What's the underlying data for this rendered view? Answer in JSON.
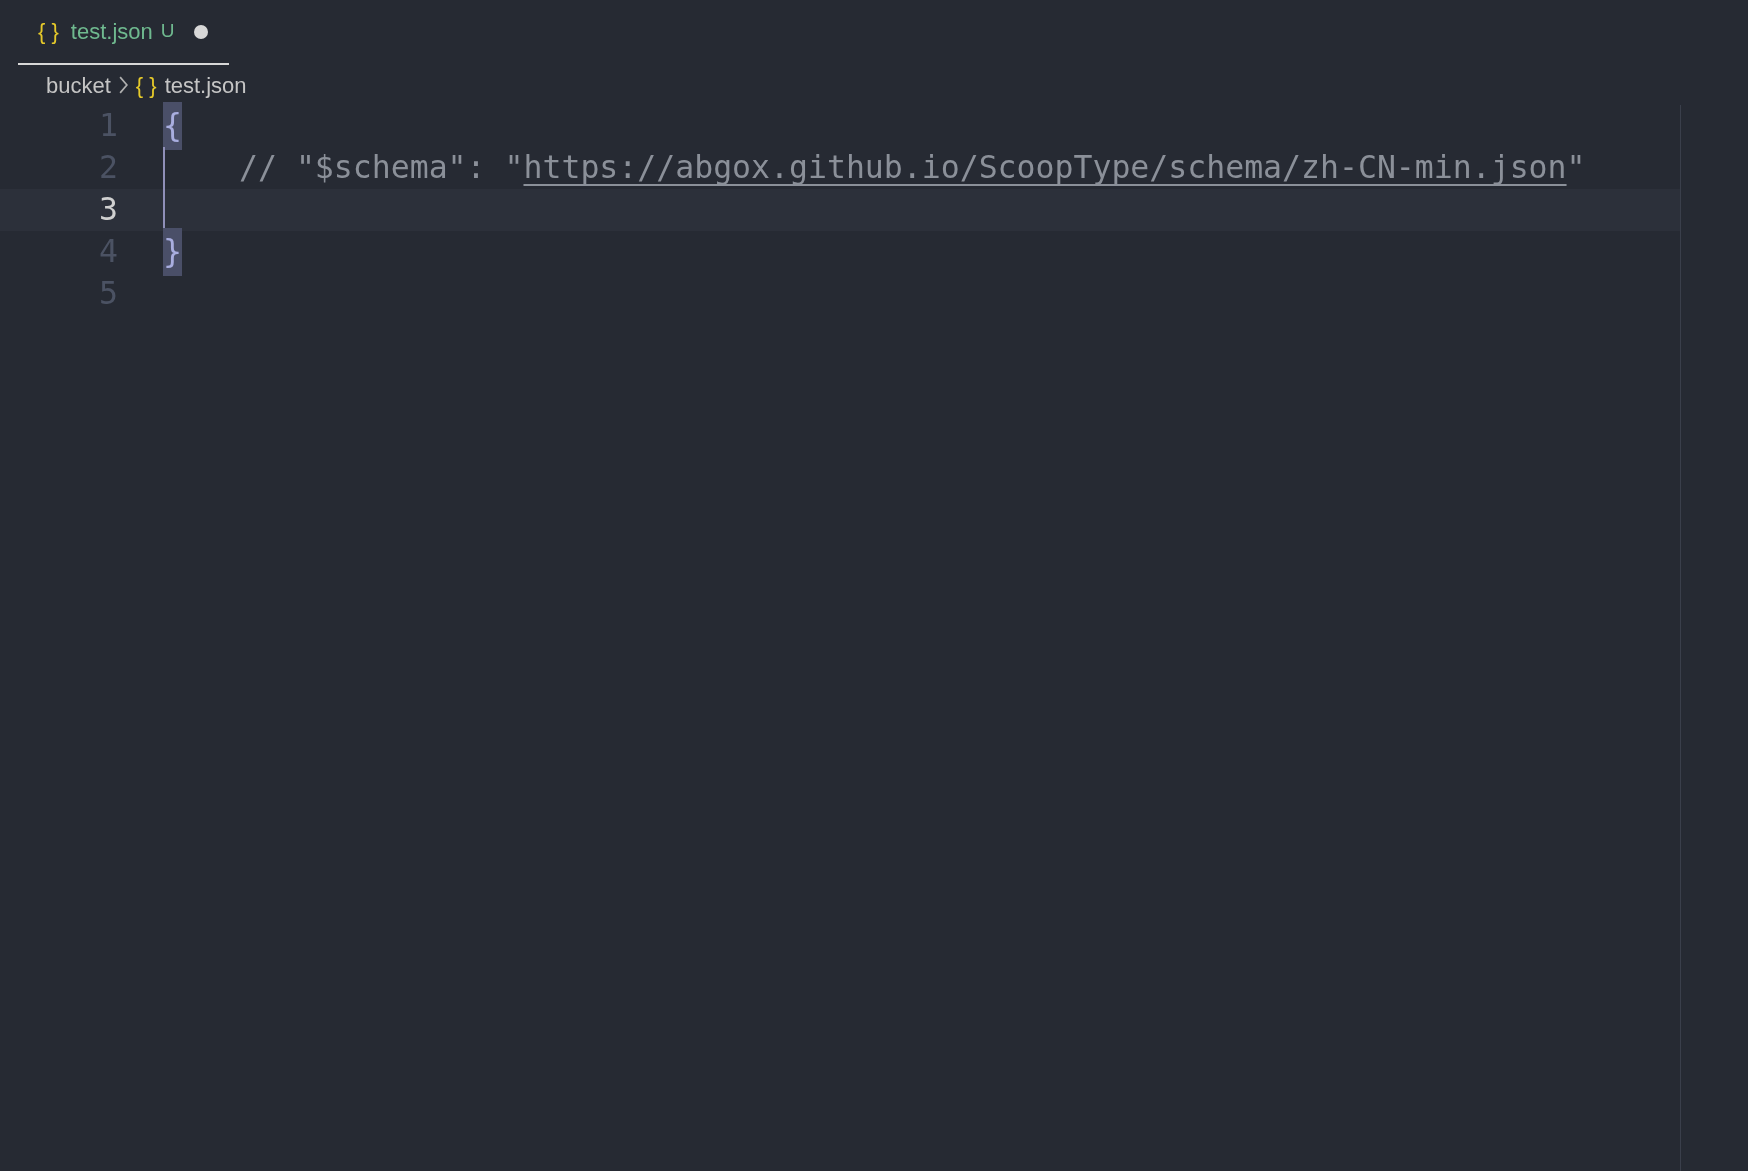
{
  "tab": {
    "icon_text": "{ }",
    "label": "test.json",
    "status": "U",
    "dirty": true,
    "selected": true
  },
  "breadcrumb": [
    {
      "label": "bucket"
    },
    {
      "label": "test.json",
      "icon_text": "{ }"
    }
  ],
  "lines": [
    {
      "number": "1",
      "current": false,
      "indented": false,
      "segments": [
        {
          "kind": "bracket",
          "text": "{",
          "matched": true
        }
      ]
    },
    {
      "number": "2",
      "current": false,
      "indented": true,
      "segments": [
        {
          "kind": "comment",
          "text": "// \"$schema\": \""
        },
        {
          "kind": "link",
          "text": "https://abgox.github.io/ScoopType/schema/zh-CN-min.json"
        },
        {
          "kind": "comment",
          "text": "\""
        }
      ]
    },
    {
      "number": "3",
      "current": true,
      "indented": true
    },
    {
      "number": "4",
      "current": false,
      "indented": false,
      "segments": [
        {
          "kind": "bracket",
          "text": "}",
          "matched": true
        }
      ]
    },
    {
      "number": "5",
      "current": false,
      "indented": false
    }
  ]
}
